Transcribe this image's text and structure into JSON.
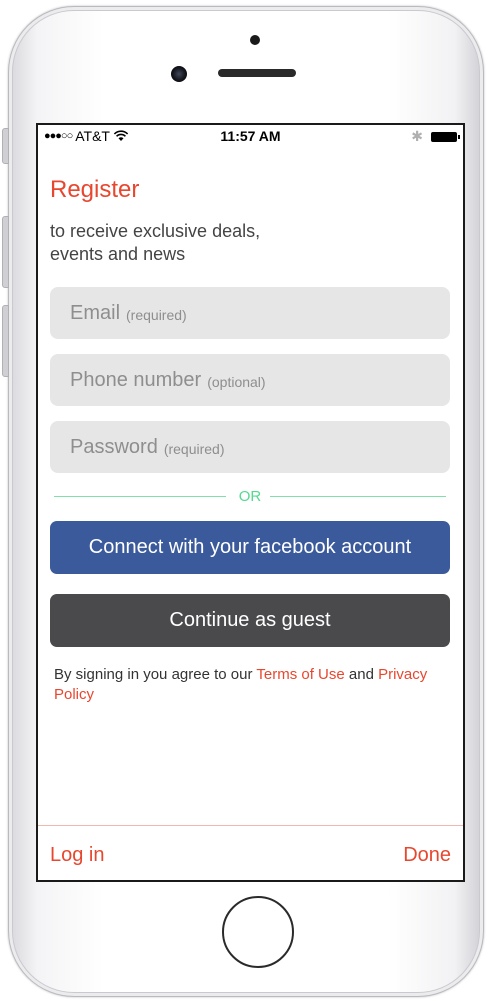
{
  "status_bar": {
    "signal": "●●●○○",
    "carrier": "AT&T",
    "wifi_icon": "wifi-icon",
    "time": "11:57 AM",
    "bluetooth_glyph": "✱",
    "battery_icon": "battery-icon"
  },
  "register": {
    "title": "Register",
    "subtitle": "to receive exclusive deals, events and news"
  },
  "fields": {
    "email": {
      "label": "Email",
      "hint": "(required)"
    },
    "phone": {
      "label": "Phone number",
      "hint": "(optional)"
    },
    "password": {
      "label": "Password",
      "hint": "(required)"
    }
  },
  "divider": {
    "text": "OR"
  },
  "buttons": {
    "facebook": "Connect with your facebook account",
    "guest": "Continue as guest"
  },
  "terms": {
    "prefix": "By signing in you agree to our ",
    "terms_link": "Terms of Use",
    "and": " and ",
    "privacy_link": "Privacy Policy"
  },
  "bottom_bar": {
    "login": "Log in",
    "done": "Done"
  },
  "colors": {
    "accent": "#e8472f",
    "facebook": "#3b5a9b",
    "guest": "#4a4a4c",
    "divider": "#7fe0a8"
  }
}
